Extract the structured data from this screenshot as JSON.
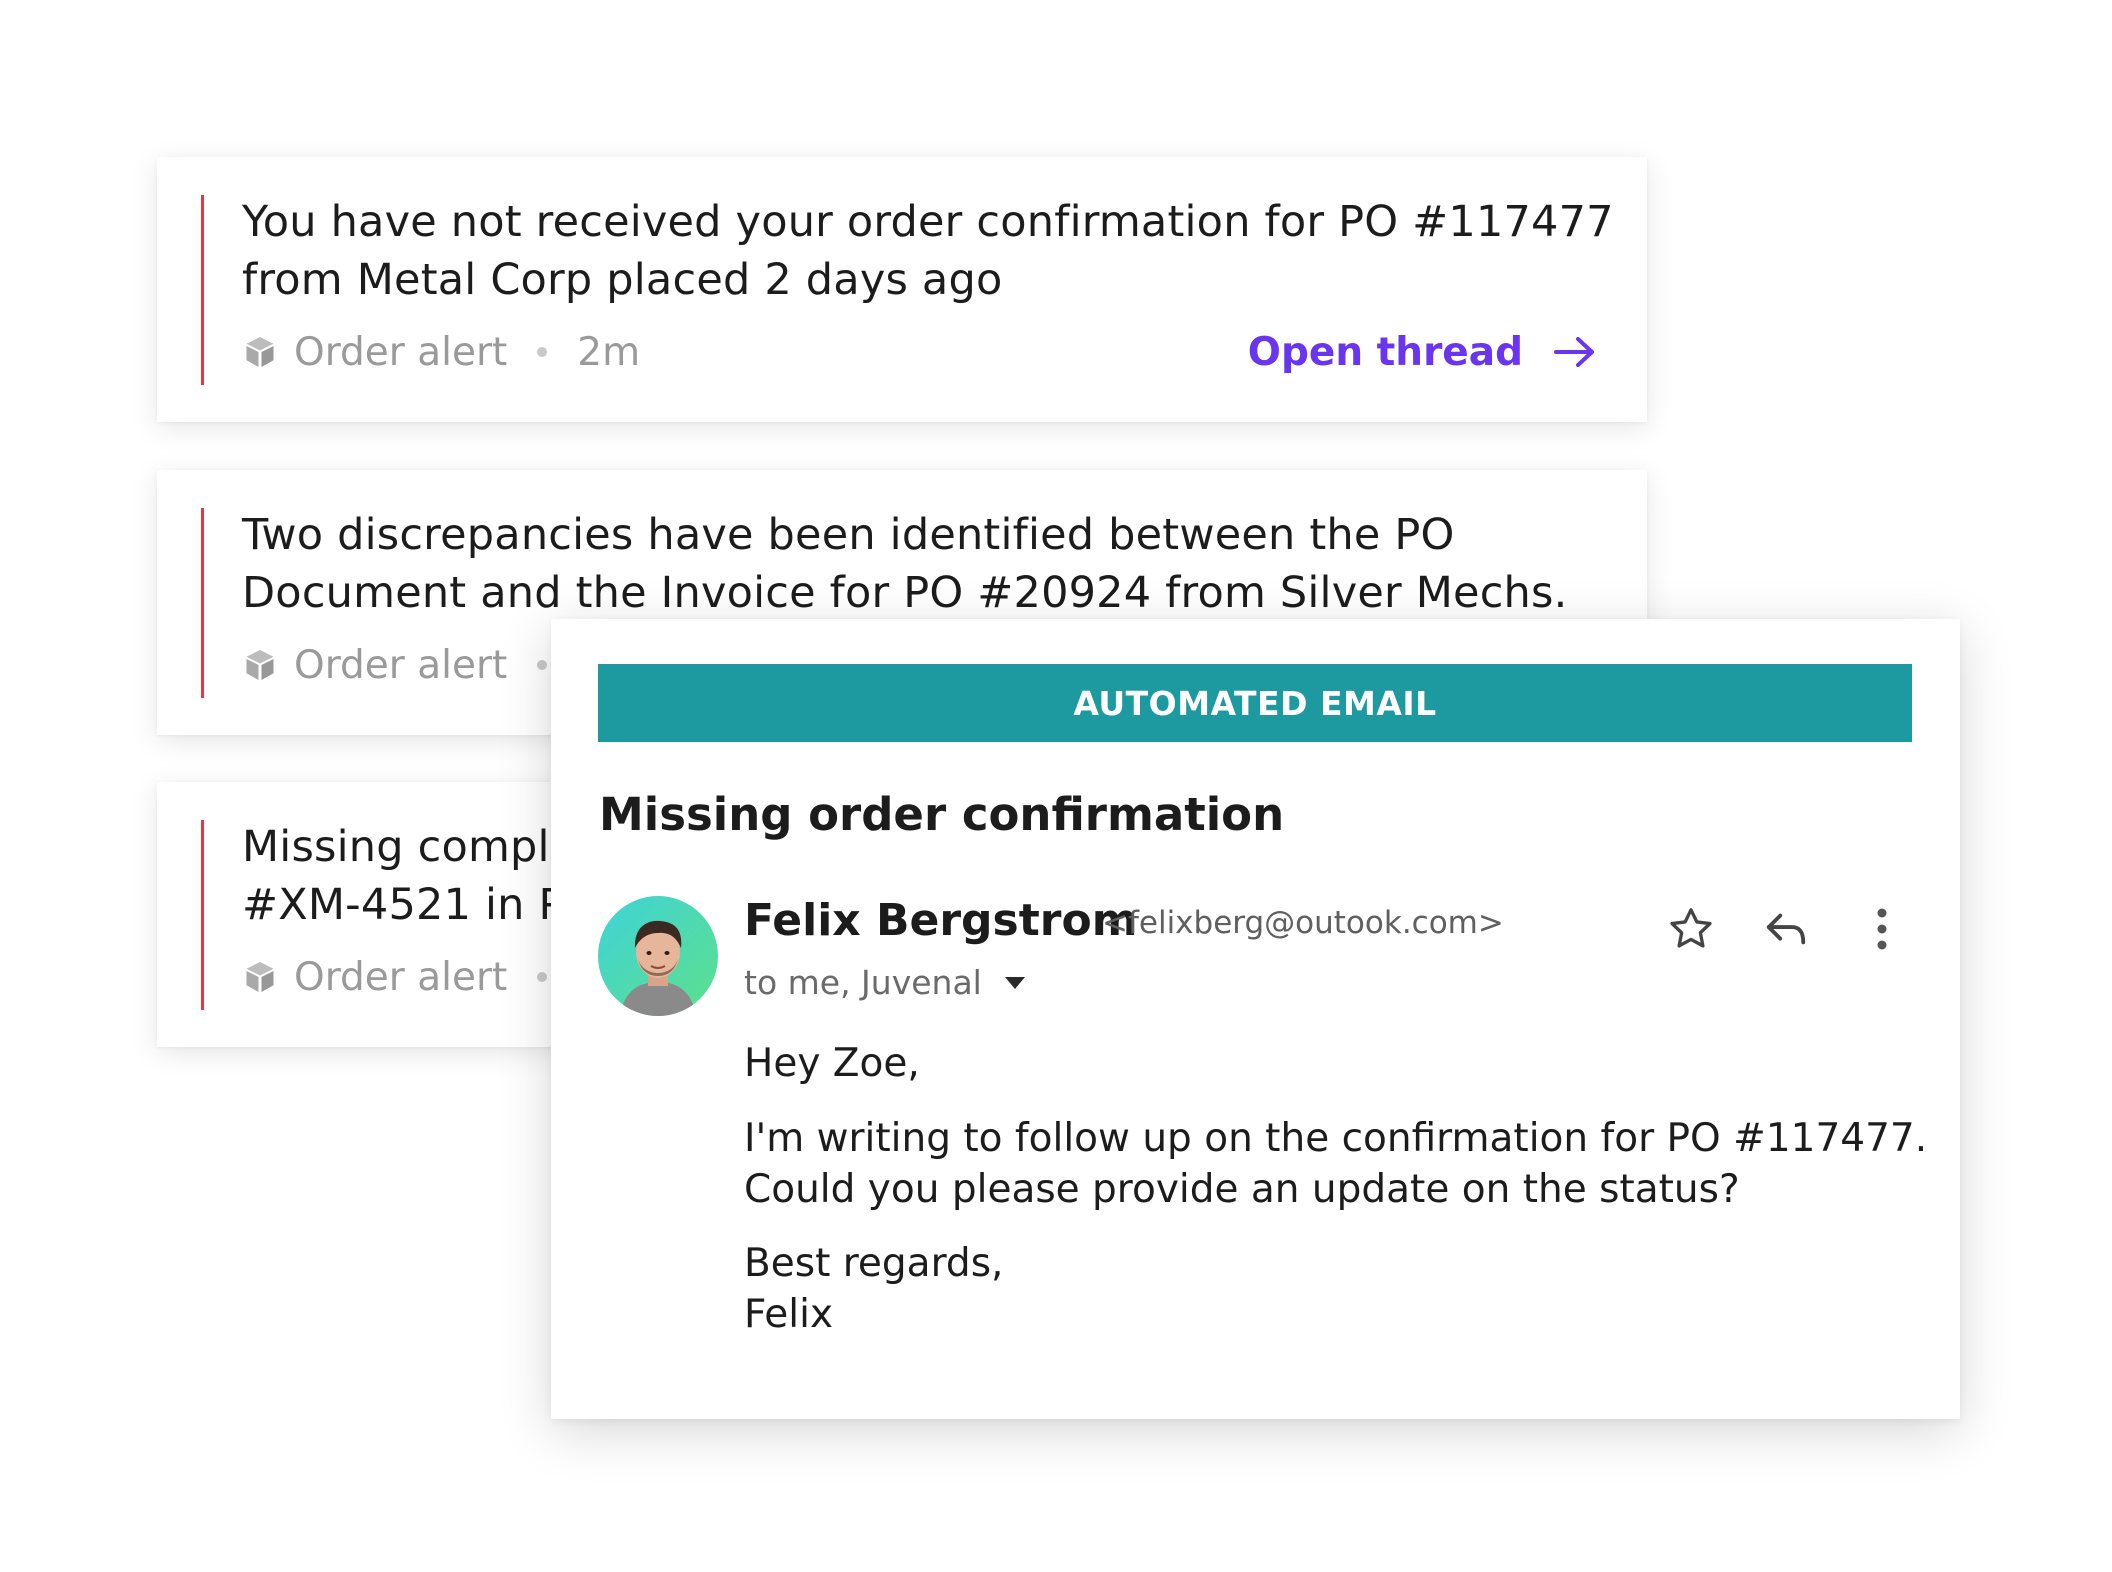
{
  "alerts": [
    {
      "message_line1": "You have not received your order confirmation for PO #117477",
      "message_line2": "from Metal Corp placed 2 days ago",
      "category": "Order alert",
      "time": "2m",
      "action_label": "Open thread",
      "icon": "cube-icon"
    },
    {
      "message_line1": "Two discrepancies have been identified between the PO",
      "message_line2": "Document and the Invoice for PO #20924 from Silver Mechs.",
      "category": "Order alert",
      "icon": "cube-icon"
    },
    {
      "message_line1": "Missing compl",
      "message_line2": "#XM-4521 in P",
      "category": "Order alert",
      "icon": "cube-icon"
    }
  ],
  "email": {
    "banner": "AUTOMATED EMAIL",
    "subject": "Missing order confirmation",
    "sender_name": "Felix Bergstrom",
    "sender_email": "<felixberg@outook.com>",
    "recipients": "to me, Juvenal",
    "greeting": "Hey Zoe,",
    "body_line1": "I'm writing to follow up on the confirmation for PO #117477.",
    "body_line2": "Could you please provide an update on the status?",
    "signoff": "Best regards,",
    "signature": "Felix",
    "icons": [
      "star-icon",
      "reply-icon",
      "more-vert-icon",
      "caret-down-icon"
    ]
  },
  "colors": {
    "alert_bar": "#e0393e",
    "link": "#6a35f0",
    "banner": "#1c9aa0",
    "avatar_gradient": [
      "#3fd3d9",
      "#5de08a"
    ]
  }
}
